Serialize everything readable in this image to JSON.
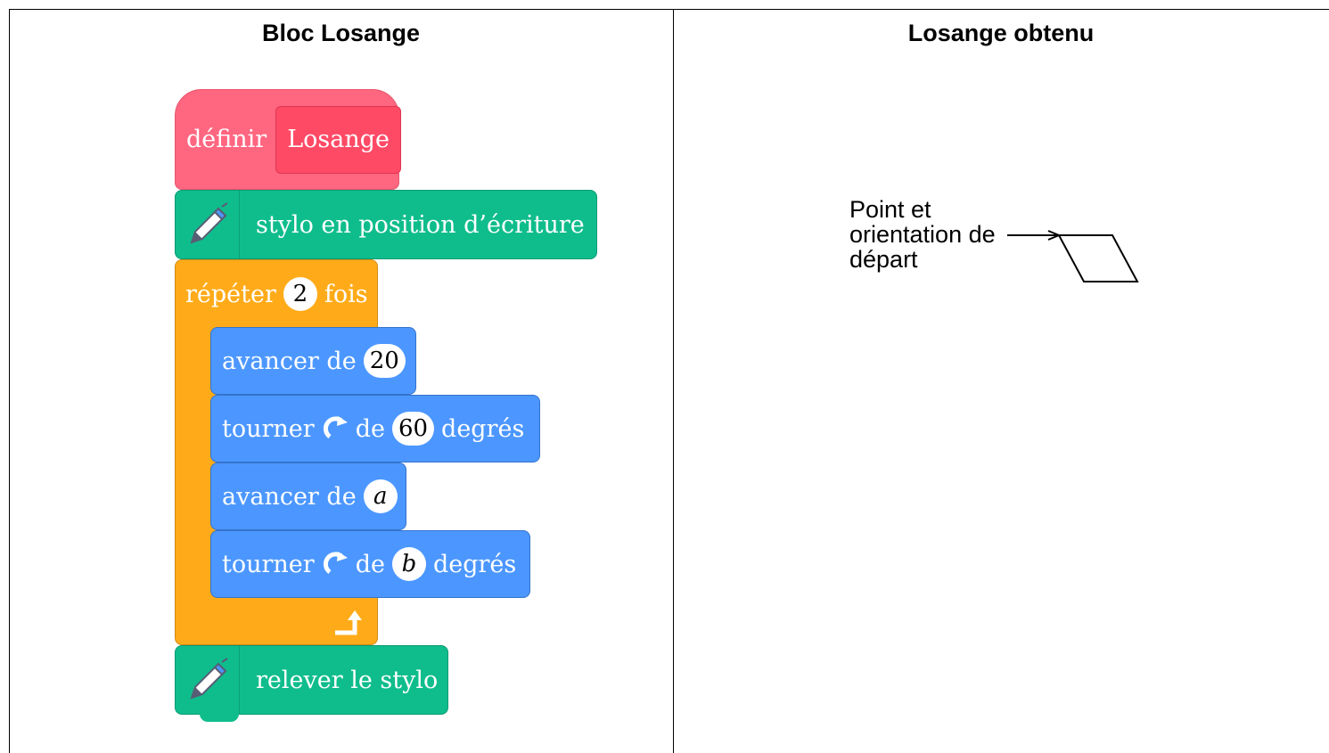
{
  "headers": {
    "left": "Bloc Losange",
    "right": "Losange obtenu"
  },
  "blocks": {
    "define": {
      "prefix": "définir",
      "name": "Losange"
    },
    "pen_down": {
      "label": "stylo en position d’écriture",
      "icon": "pen-icon"
    },
    "repeat": {
      "prefix": "répéter",
      "count": "2",
      "suffix": "fois",
      "end_icon": "loop-arrow-icon"
    },
    "move1": {
      "label": "avancer de",
      "value": "20"
    },
    "turn1": {
      "label": "tourner",
      "icon": "rotate-clockwise-icon",
      "mid": "de",
      "value": "60",
      "suffix": "degrés"
    },
    "move2": {
      "label": "avancer de",
      "value": "a"
    },
    "turn2": {
      "label": "tourner",
      "icon": "rotate-clockwise-icon",
      "mid": "de",
      "value": "b",
      "suffix": "degrés"
    },
    "pen_up": {
      "label": "relever le stylo",
      "icon": "pen-icon"
    }
  },
  "figure": {
    "start_label_lines": [
      "Point et",
      "orientation de",
      "départ"
    ]
  },
  "colors": {
    "define": "#ff6680",
    "define_inner": "#ff4a66",
    "pen": "#0fbd8c",
    "control": "#ffab19",
    "motion": "#4c97ff"
  }
}
